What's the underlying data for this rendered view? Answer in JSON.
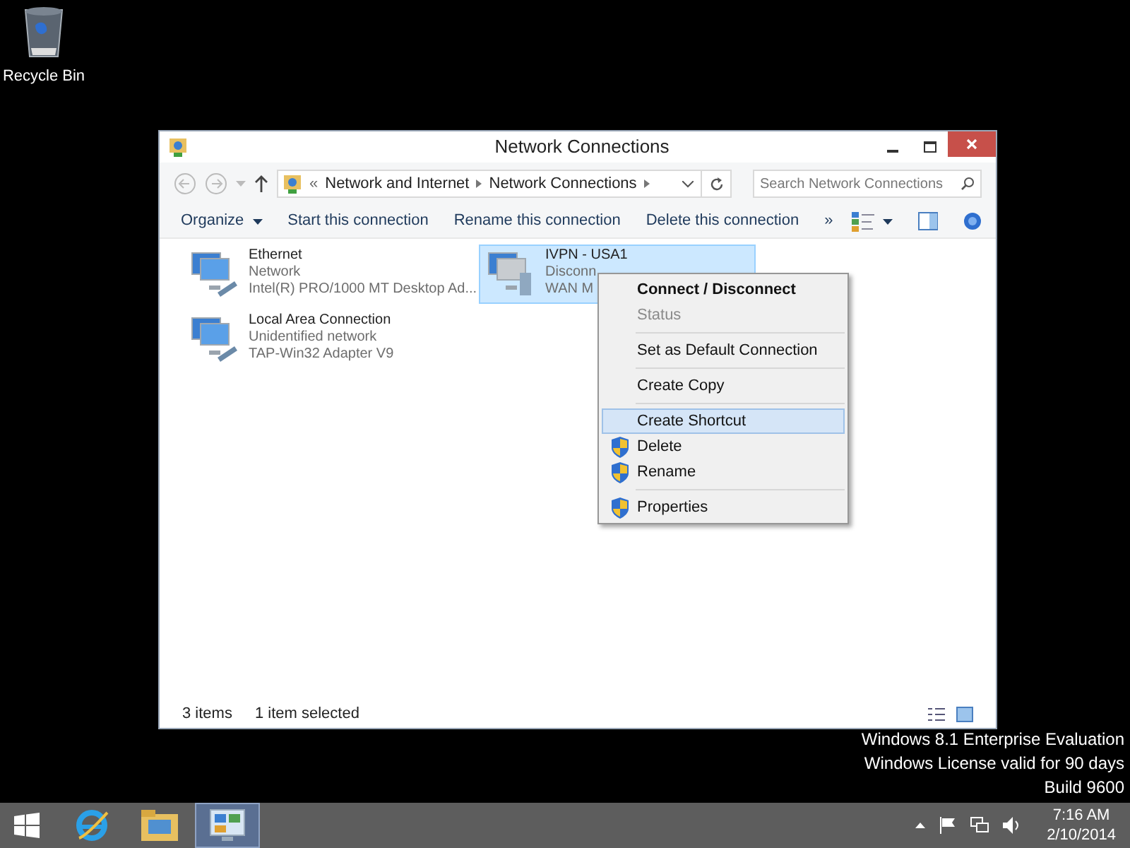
{
  "desktop_icons": [
    {
      "label": "Recycle Bin"
    }
  ],
  "window": {
    "title": "Network Connections",
    "address": {
      "prefix": "«",
      "path": [
        "Network and Internet",
        "Network Connections"
      ]
    },
    "search": {
      "placeholder": "Search Network Connections"
    },
    "toolbar": [
      {
        "label": "Organize",
        "dropdown": true
      },
      {
        "label": "Start this connection",
        "dropdown": false
      },
      {
        "label": "Rename this connection",
        "dropdown": false
      },
      {
        "label": "Delete this connection",
        "dropdown": false
      },
      {
        "label": "»",
        "dropdown": false
      }
    ],
    "connections": [
      {
        "name": "Ethernet",
        "status": "Network",
        "device": "Intel(R) PRO/1000 MT Desktop Ad...",
        "kind": "lan",
        "selected": false
      },
      {
        "name": "IVPN - USA1",
        "status": "Disconn",
        "device": "WAN M",
        "kind": "vpn",
        "selected": true
      },
      {
        "name": "Local Area Connection",
        "status": "Unidentified network",
        "device": "TAP-Win32 Adapter V9",
        "kind": "lan",
        "selected": false
      }
    ],
    "context_menu": {
      "items": [
        {
          "kind": "item",
          "label": "Connect / Disconnect",
          "bold": true,
          "disabled": false,
          "selected": false,
          "shield": false
        },
        {
          "kind": "item",
          "label": "Status",
          "bold": false,
          "disabled": true,
          "selected": false,
          "shield": false
        },
        {
          "kind": "separator"
        },
        {
          "kind": "item",
          "label": "Set as Default Connection",
          "bold": false,
          "disabled": false,
          "selected": false,
          "shield": false
        },
        {
          "kind": "separator"
        },
        {
          "kind": "item",
          "label": "Create Copy",
          "bold": false,
          "disabled": false,
          "selected": false,
          "shield": false
        },
        {
          "kind": "separator"
        },
        {
          "kind": "item",
          "label": "Create Shortcut",
          "bold": false,
          "disabled": false,
          "selected": true,
          "shield": false
        },
        {
          "kind": "item",
          "label": "Delete",
          "bold": false,
          "disabled": false,
          "selected": false,
          "shield": true
        },
        {
          "kind": "item",
          "label": "Rename",
          "bold": false,
          "disabled": false,
          "selected": false,
          "shield": true
        },
        {
          "kind": "separator"
        },
        {
          "kind": "item",
          "label": "Properties",
          "bold": false,
          "disabled": false,
          "selected": false,
          "shield": true
        }
      ]
    },
    "status_bar": {
      "count": "3 items",
      "selection": "1 item selected"
    }
  },
  "watermark": [
    "Windows 8.1 Enterprise Evaluation",
    "Windows License valid for 90 days",
    "Build 9600"
  ],
  "taskbar": {
    "apps": [
      {
        "kind": "browser",
        "selected": false
      },
      {
        "kind": "folder",
        "selected": false
      },
      {
        "kind": "network",
        "selected": true
      }
    ],
    "clock": {
      "time": "7:16 AM",
      "date": "2/10/2014"
    }
  }
}
